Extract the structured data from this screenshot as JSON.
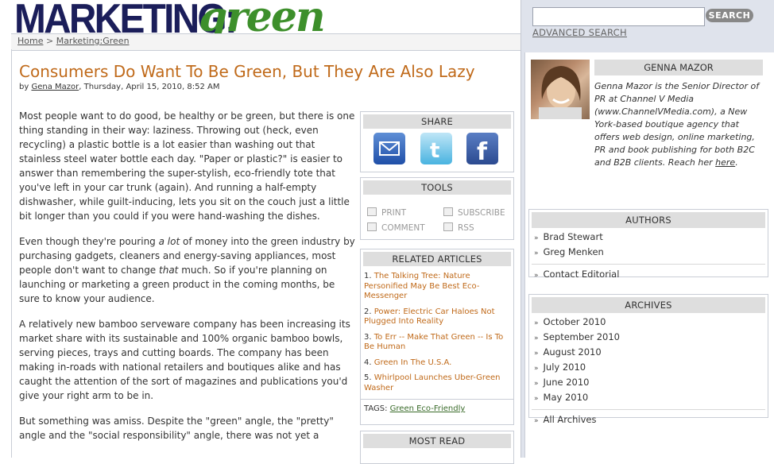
{
  "logo": {
    "part1": "MARKETING:",
    "part2": "green"
  },
  "breadcrumb": {
    "home": "Home",
    "sep": " > ",
    "current": "Marketing:Green"
  },
  "search": {
    "placeholder": "",
    "button": "SEARCH",
    "advanced": "ADVANCED SEARCH"
  },
  "article": {
    "title": "Consumers Do Want To Be Green, But They Are Also Lazy",
    "by": "by ",
    "author": "Gena Mazor",
    "date": ", Thursday, April 15, 2010, 8:52 AM",
    "paragraphs": [
      "Most people want to do good, be healthy or be green, but there is one thing standing in their way: laziness. Throwing out (heck, even recycling) a plastic bottle is a lot easier than washing out that stainless steel water bottle each day. \"Paper or plastic?\" is easier to answer than remembering the super-stylish, eco-friendly tote that you've left in your car trunk (again). And running a half-empty dishwasher, while guilt-inducing, lets you sit on the couch just a little bit longer than you could if you were hand-washing the dishes.",
      "A relatively new bamboo serveware company has been increasing its market share with its sustainable and 100% organic bamboo bowls, serving pieces, trays and cutting boards. The company has been making in-roads with national retailers and boutiques alike and has caught the attention of the sort of magazines and publications you'd give your right arm to be in.",
      "But something was amiss. Despite the \"green\" angle, the \"pretty\" angle and the \"social responsibility\" angle, there was not yet a"
    ],
    "p2": {
      "a": "Even though they're pouring ",
      "b": "a lot",
      "c": " of money into the green industry by purchasing gadgets, cleaners and energy-saving appliances, most people don't want to change ",
      "d": "that",
      "e": " much. So if you're planning on launching or marketing a green product in the coming months, be sure to know your audience."
    }
  },
  "share": {
    "header": "SHARE",
    "icons": [
      "email-icon",
      "twitter-icon",
      "facebook-icon"
    ]
  },
  "tools": {
    "header": "TOOLS",
    "print": "PRINT",
    "subscribe": "SUBSCRIBE",
    "comment": "COMMENT",
    "rss": "RSS"
  },
  "related": {
    "header": "RELATED ARTICLES",
    "items": [
      {
        "num": "1. ",
        "title": "The Talking Tree: Nature Personified May Be Best Eco-Messenger"
      },
      {
        "num": "2. ",
        "title": "Power: Electric Car Haloes Not Plugged Into Reality"
      },
      {
        "num": "3. ",
        "title": "To Err -- Make That Green -- Is To Be Human"
      },
      {
        "num": "4. ",
        "title": "Green In The U.S.A."
      },
      {
        "num": "5. ",
        "title": "Whirlpool Launches Uber-Green Washer"
      }
    ],
    "tags_label": "TAGS: ",
    "tags_value": "Green Eco-Friendly"
  },
  "most_read": {
    "header": "MOST READ"
  },
  "author_box": {
    "name": "GENNA MAZOR",
    "bio": "Genna Mazor is the Senior Director of PR at Channel V Media (www.ChannelVMedia.com), a New York-based boutique agency that offers web design, online marketing, PR and book publishing for both B2C and B2B clients. Reach her ",
    "link": "here",
    "end": "."
  },
  "authors": {
    "header": "AUTHORS",
    "items": [
      "Brad Stewart",
      "Greg Menken"
    ],
    "contact": "Contact Editorial"
  },
  "archives": {
    "header": "ARCHIVES",
    "items": [
      "October 2010",
      "September 2010",
      "August 2010",
      "July 2010",
      "June 2010",
      "May 2010"
    ],
    "all": "All Archives"
  }
}
